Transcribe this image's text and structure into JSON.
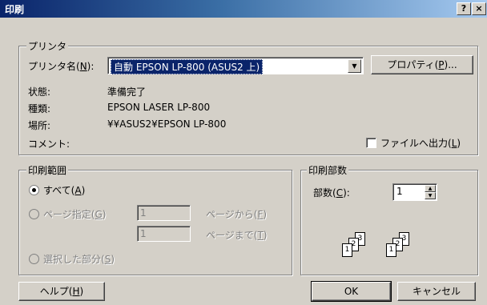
{
  "window": {
    "title": "印刷",
    "help_btn": "?",
    "close_btn": "×"
  },
  "printer_group": {
    "label": "プリンタ",
    "name_label": "プリンタ名(N):",
    "selected_printer": "自動 EPSON LP-800 (ASUS2 上)",
    "properties_button": "プロパティ(P)...",
    "status_label": "状態:",
    "status_value": "準備完了",
    "type_label": "種類:",
    "type_value": "EPSON LASER LP-800",
    "location_label": "場所:",
    "location_value": "¥¥ASUS2¥EPSON LP-800",
    "comment_label": "コメント:",
    "comment_value": "",
    "print_to_file_label": "ファイルへ出力(L)",
    "print_to_file_checked": false
  },
  "range_group": {
    "label": "印刷範囲",
    "all_label": "すべて(A)",
    "pages_label": "ページ指定(G)",
    "from_value": "1",
    "from_label": "ページから(F)",
    "to_value": "1",
    "to_label": "ページまで(T)",
    "selection_label": "選択した部分(S)",
    "selected": "all"
  },
  "copies_group": {
    "label": "印刷部数",
    "count_label": "部数(C):",
    "count_value": "1",
    "collate_pages": [
      "1",
      "2",
      "3"
    ]
  },
  "footer": {
    "help_button": "ヘルプ(H)",
    "ok_button": "OK",
    "cancel_button": "キャンセル"
  }
}
